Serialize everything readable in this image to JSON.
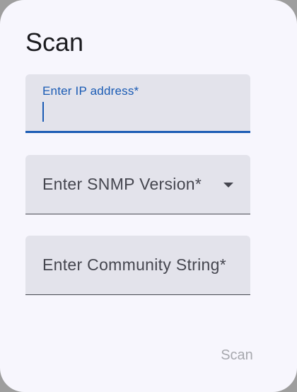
{
  "dialog": {
    "title": "Scan"
  },
  "fields": {
    "ip_address": {
      "label": "Enter IP address*",
      "value": ""
    },
    "snmp_version": {
      "label": "Enter SNMP Version*",
      "icon": "arrow-drop-down-icon"
    },
    "community_string": {
      "label": "Enter Community String*"
    }
  },
  "actions": {
    "scan_label": "Scan",
    "scan_enabled": false
  },
  "colors": {
    "accent": "#1a5bb4",
    "surface": "#f7f6fd",
    "field_fill": "#e3e3eb",
    "disabled_text": "#a7a8ae"
  }
}
